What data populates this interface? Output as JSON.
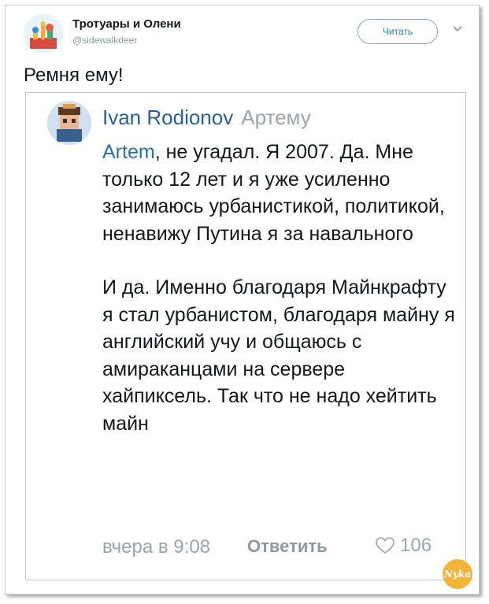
{
  "header": {
    "account_name": "Тротуары и Олени",
    "account_handle": "@sidewalkdeer",
    "follow_label": "Читать"
  },
  "tweet": {
    "text": "Ремня ему!"
  },
  "quoted": {
    "author": "Ivan Rodionov",
    "reply_to": "Артему",
    "mention": "Artem",
    "paragraph1_rest": ", не угадал. Я 2007. Да. Мне только 12 лет и я уже усиленно занимаюсь урбанистикой, политикой, ненавижу Путина  я за навального",
    "paragraph2": "И да. Именно благодаря Майнкрафту я стал урбанистом, благодаря майну я английский учу и общаюсь с амираканцами на сервере хайпиксель. Так что не надо хейтить майн",
    "time": "вчера в 9:08",
    "reply_label": "Ответить",
    "likes": "106"
  },
  "watermark": {
    "text": "Nyka"
  },
  "colors": {
    "link": "#2b6fa8",
    "muted": "#9aa5b0",
    "follow": "#2b7bb9"
  }
}
